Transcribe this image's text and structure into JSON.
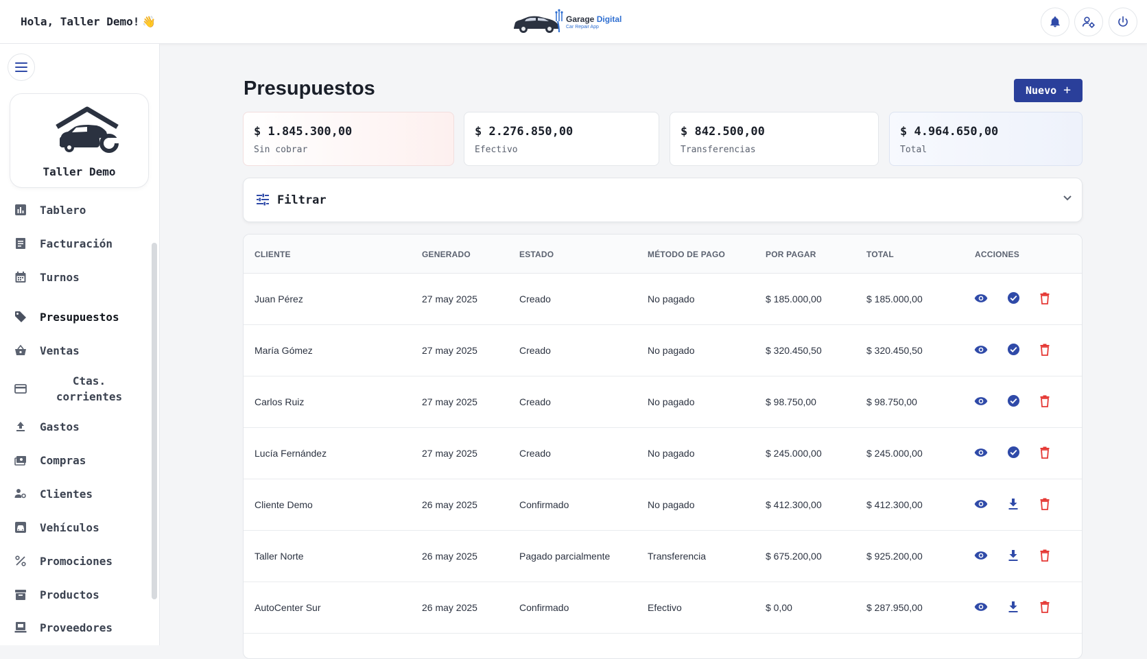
{
  "header": {
    "greeting": "Hola, Taller Demo!",
    "wave_emoji": "👋",
    "logo": {
      "title_plain": "Garage",
      "title_accent": "Digital",
      "subtitle": "Car Repair App"
    }
  },
  "profile": {
    "name": "Taller Demo"
  },
  "sidebar": {
    "items": [
      {
        "label": "Tablero",
        "icon": "chart-icon"
      },
      {
        "label": "Facturación",
        "icon": "receipt-icon"
      },
      {
        "label": "Turnos",
        "icon": "calendar-icon"
      },
      {
        "label": "Presupuestos",
        "icon": "tag-icon",
        "active": true
      },
      {
        "label": "Ventas",
        "icon": "basket-icon"
      },
      {
        "label": "Ctas. corrientes",
        "icon": "card-icon"
      },
      {
        "label": "Gastos",
        "icon": "upload-icon"
      },
      {
        "label": "Compras",
        "icon": "money-icon"
      },
      {
        "label": "Clientes",
        "icon": "users-icon"
      },
      {
        "label": "Vehículos",
        "icon": "car-icon"
      },
      {
        "label": "Promociones",
        "icon": "percent-icon"
      },
      {
        "label": "Productos",
        "icon": "archive-icon"
      },
      {
        "label": "Proveedores",
        "icon": "store-icon"
      }
    ]
  },
  "page": {
    "title": "Presupuestos",
    "new_label": "Nuevo"
  },
  "stats": [
    {
      "value": "$ 1.845.300,00",
      "caption": "Sin cobrar"
    },
    {
      "value": "$ 2.276.850,00",
      "caption": "Efectivo"
    },
    {
      "value": "$ 842.500,00",
      "caption": "Transferencias"
    },
    {
      "value": "$ 4.964.650,00",
      "caption": "Total"
    }
  ],
  "filter": {
    "label": "Filtrar"
  },
  "table": {
    "columns": [
      "CLIENTE",
      "GENERADO",
      "ESTADO",
      "MÉTODO DE PAGO",
      "POR PAGAR",
      "TOTAL",
      "ACCIONES"
    ],
    "rows": [
      {
        "cliente": "Juan Pérez",
        "generado": "27 may 2025",
        "estado": "Creado",
        "metodo": "No pagado",
        "por_pagar": "$ 185.000,00",
        "total": "$ 185.000,00",
        "action2": "check"
      },
      {
        "cliente": "María Gómez",
        "generado": "27 may 2025",
        "estado": "Creado",
        "metodo": "No pagado",
        "por_pagar": "$ 320.450,50",
        "total": "$ 320.450,50",
        "action2": "check"
      },
      {
        "cliente": "Carlos Ruiz",
        "generado": "27 may 2025",
        "estado": "Creado",
        "metodo": "No pagado",
        "por_pagar": "$ 98.750,00",
        "total": "$ 98.750,00",
        "action2": "check"
      },
      {
        "cliente": "Lucía Fernández",
        "generado": "27 may 2025",
        "estado": "Creado",
        "metodo": "No pagado",
        "por_pagar": "$ 245.000,00",
        "total": "$ 245.000,00",
        "action2": "check"
      },
      {
        "cliente": "Cliente Demo",
        "generado": "26 may 2025",
        "estado": "Confirmado",
        "metodo": "No pagado",
        "por_pagar": "$ 412.300,00",
        "total": "$ 412.300,00",
        "action2": "download"
      },
      {
        "cliente": "Taller Norte",
        "generado": "26 may 2025",
        "estado": "Pagado parcialmente",
        "metodo": "Transferencia",
        "por_pagar": "$ 675.200,00",
        "total": "$ 925.200,00",
        "action2": "download"
      },
      {
        "cliente": "AutoCenter Sur",
        "generado": "26 may 2025",
        "estado": "Confirmado",
        "metodo": "Efectivo",
        "por_pagar": "$ 0,00",
        "total": "$ 287.950,00",
        "action2": "download"
      }
    ]
  },
  "colors": {
    "primary": "#2a3f9a",
    "action_blue": "#2f4aa8",
    "danger": "#e53935"
  }
}
